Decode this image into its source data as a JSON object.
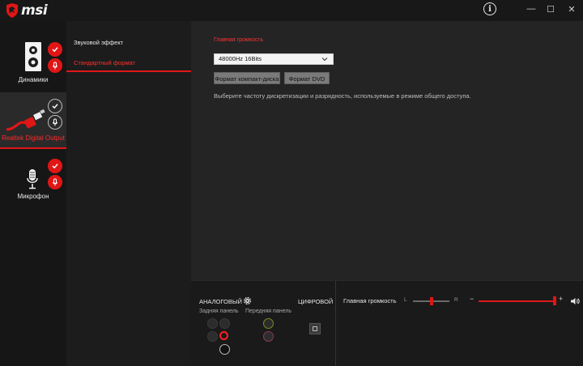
{
  "titlebar": {
    "logo_text": "msi",
    "info_glyph": "i",
    "min_glyph": "—",
    "max_glyph": "☐",
    "close_glyph": "✕"
  },
  "devices": [
    {
      "label": "Динамики",
      "icon": "speaker-icon",
      "active": false
    },
    {
      "label": "Realtek Digital Output",
      "icon": "cable-icon",
      "active": true
    },
    {
      "label": "Микрофон",
      "icon": "microphone-icon",
      "active": false
    }
  ],
  "subnav": {
    "items": [
      {
        "label": "Звуковой эффект",
        "selected": false
      },
      {
        "label": "Стандартный формат",
        "selected": true
      }
    ]
  },
  "main": {
    "section_title": "Главная громкость",
    "format_select": {
      "value": "48000Hz 16Bits"
    },
    "buttons": {
      "cd": "Формат компакт-диска",
      "dvd": "Формат DVD"
    },
    "help_text": "Выберите частоту дискретизации и разрядность, используемые в режиме общего доступа."
  },
  "jacks": {
    "analog_title": "АНАЛОГОВЫЙ",
    "digital_title": "ЦИФРОВОЙ",
    "rear_label": "Задняя панель",
    "front_label": "Передняя панель"
  },
  "volume": {
    "title": "Главная громкость",
    "left_label": "L",
    "right_label": "R",
    "minus": "−",
    "plus": "+",
    "balance": 0.5,
    "level": 1.0
  },
  "colors": {
    "accent": "#e01616",
    "background": "#222222"
  }
}
